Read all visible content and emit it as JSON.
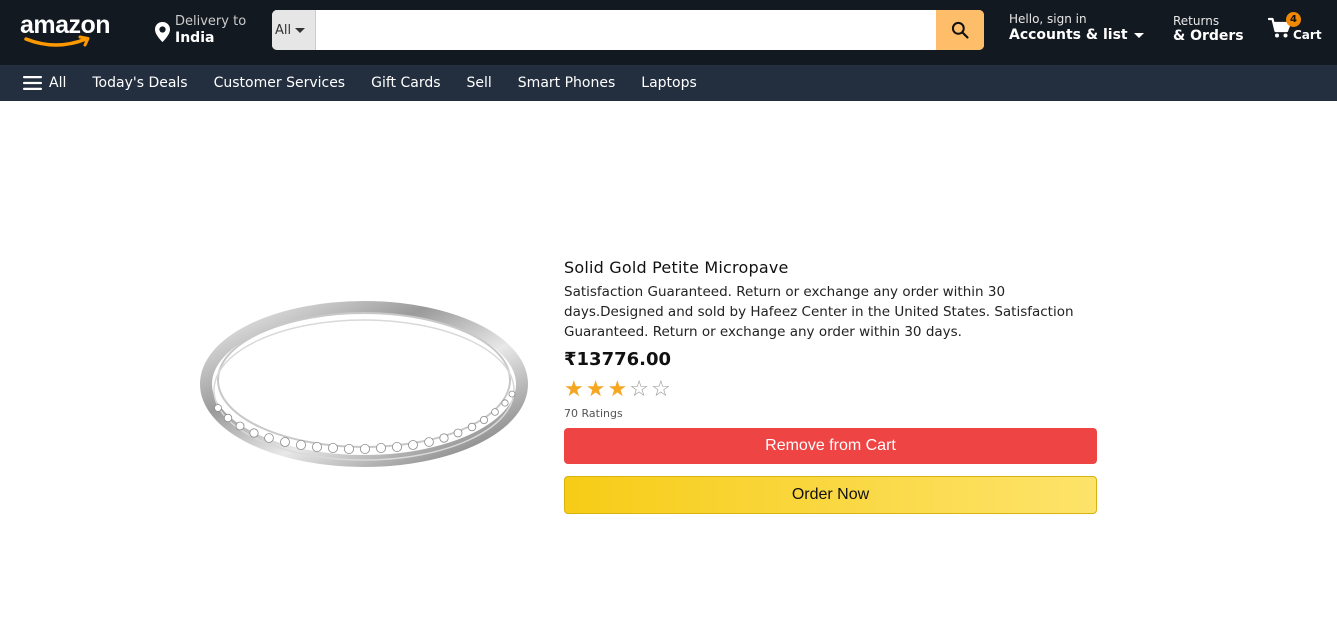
{
  "header": {
    "logo_text": "amazon",
    "delivery": {
      "line1": "Delivery to",
      "line2": "India"
    },
    "search": {
      "category": "All",
      "placeholder": ""
    },
    "account": {
      "line1": "Hello, sign in",
      "line2": "Accounts & list"
    },
    "returns": {
      "line1": "Returns",
      "line2": "& Orders"
    },
    "cart": {
      "count": "4",
      "label": "Cart"
    }
  },
  "nav": {
    "all_label": "All",
    "items": [
      "Today's Deals",
      "Customer Services",
      "Gift Cards",
      "Sell",
      "Smart Phones",
      "Laptops"
    ]
  },
  "product": {
    "title": "Solid Gold Petite Micropave",
    "description": "Satisfaction Guaranteed. Return or exchange any order within 30 days.Designed and sold by Hafeez Center in the United States. Satisfaction Guaranteed. Return or exchange any order within 30 days.",
    "price": "₹13776.00",
    "rating": 3,
    "rating_max": 5,
    "ratings_text": "70 Ratings",
    "remove_label": "Remove from Cart",
    "order_label": "Order Now"
  },
  "colors": {
    "header_bg": "#131921",
    "nav_bg": "#232f3e",
    "search_button": "#febd69",
    "remove_button": "#ef4444",
    "order_button": "#f7cc17",
    "star": "#f5a623"
  }
}
